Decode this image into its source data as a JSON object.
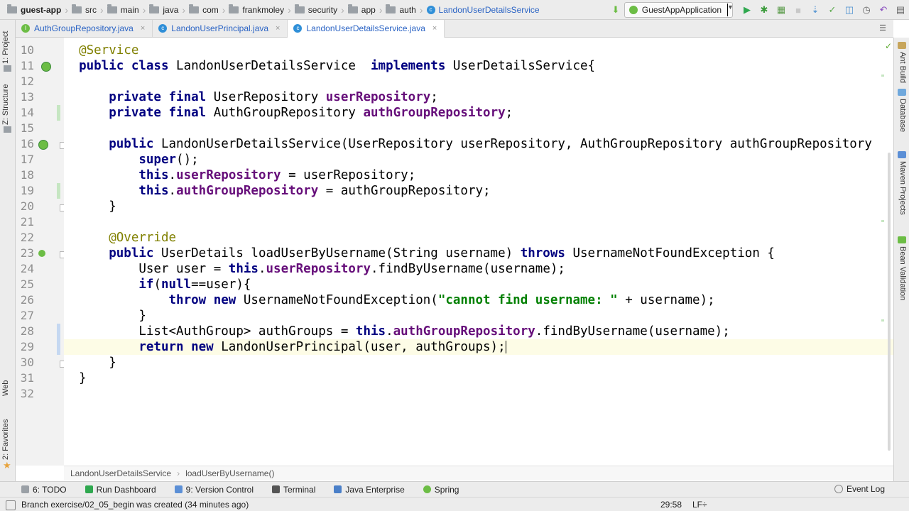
{
  "breadcrumbs": [
    {
      "label": "guest-app",
      "icon": "folder-icon"
    },
    {
      "label": "src",
      "icon": "folder-icon"
    },
    {
      "label": "main",
      "icon": "folder-icon"
    },
    {
      "label": "java",
      "icon": "folder-icon"
    },
    {
      "label": "com",
      "icon": "folder-icon"
    },
    {
      "label": "frankmoley",
      "icon": "folder-icon"
    },
    {
      "label": "security",
      "icon": "folder-icon"
    },
    {
      "label": "app",
      "icon": "folder-icon"
    },
    {
      "label": "auth",
      "icon": "folder-icon"
    },
    {
      "label": "LandonUserDetailsService",
      "icon": "class-icon"
    }
  ],
  "run_config": {
    "label": "GuestAppApplication"
  },
  "tabs": [
    {
      "label": "AuthGroupRepository.java",
      "active": false,
      "color": "#6cbd45"
    },
    {
      "label": "LandonUserPrincipal.java",
      "active": false,
      "color": "#2f8fd8"
    },
    {
      "label": "LandonUserDetailsService.java",
      "active": true,
      "color": "#2f8fd8"
    }
  ],
  "left_tools": {
    "project": "1: Project",
    "structure": "Z: Structure",
    "web": "Web",
    "favorites": "2: Favorites"
  },
  "right_tools": {
    "ant": "Ant Build",
    "database": "Database",
    "maven": "Maven Projects",
    "bean": "Bean Validation"
  },
  "editor": {
    "line_numbers": [
      "10",
      "11",
      "12",
      "13",
      "14",
      "15",
      "16",
      "17",
      "18",
      "19",
      "20",
      "21",
      "22",
      "23",
      "24",
      "25",
      "26",
      "27",
      "28",
      "29",
      "30",
      "31",
      "32"
    ]
  },
  "editor_breadcrumbs": {
    "class": "LandonUserDetailsService",
    "method": "loadUserByUsername()"
  },
  "bottom_tools": [
    {
      "label": "6: TODO",
      "icon": "todo-icon"
    },
    {
      "label": "Run Dashboard",
      "icon": "run-dashboard-icon"
    },
    {
      "label": "9: Version Control",
      "icon": "version-control-icon"
    },
    {
      "label": "Terminal",
      "icon": "terminal-icon"
    },
    {
      "label": "Java Enterprise",
      "icon": "java-enterprise-icon"
    },
    {
      "label": "Spring",
      "icon": "spring-icon"
    }
  ],
  "event_log": "Event Log",
  "status": {
    "message": "Branch exercise/02_05_begin was created (34 minutes ago)",
    "position": "29:58",
    "line_ending": "LF÷"
  },
  "colors": {
    "keyword": "#000080",
    "field": "#660e7a",
    "annotation": "#808000",
    "string": "#008000"
  }
}
